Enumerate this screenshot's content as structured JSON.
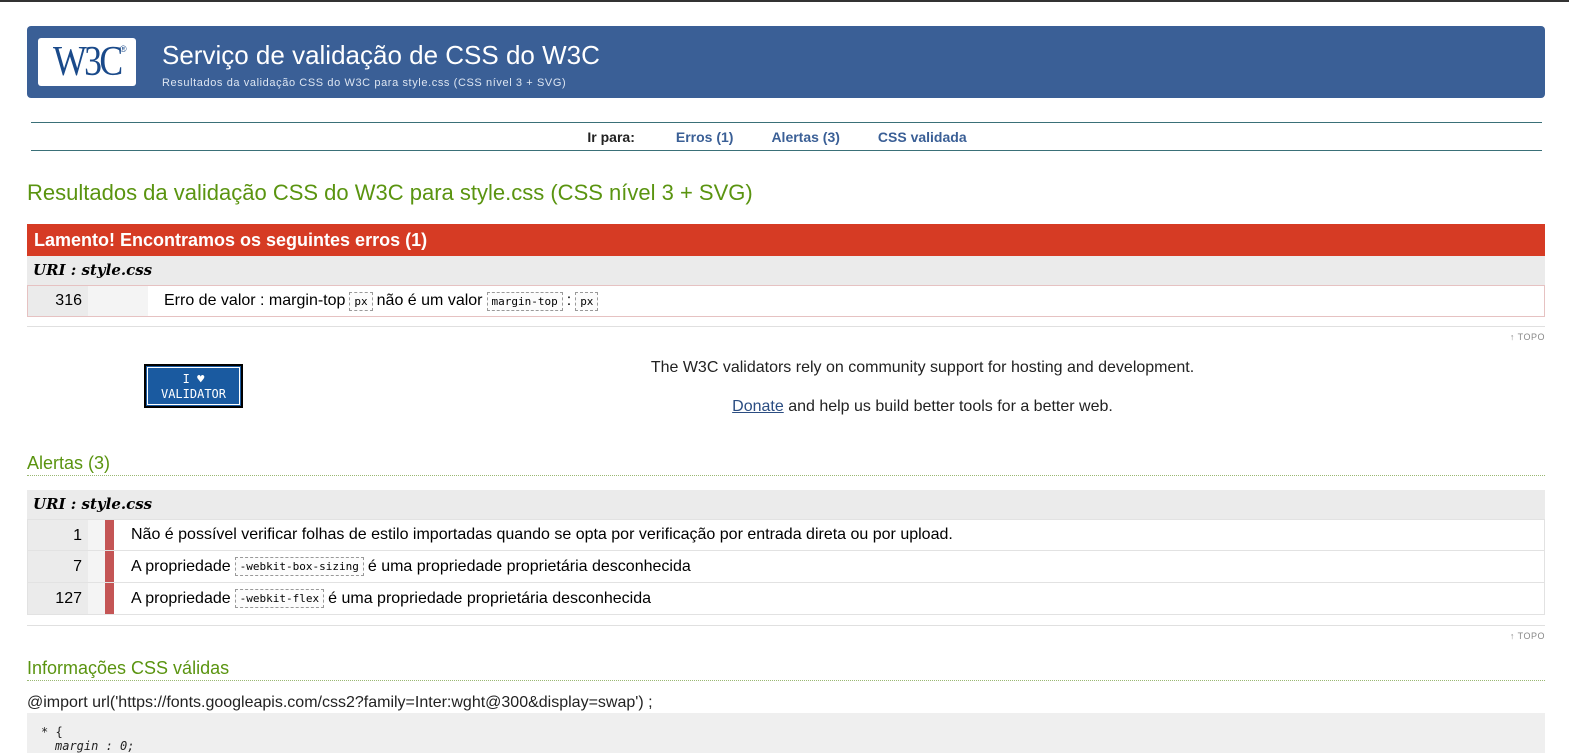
{
  "banner": {
    "logo_text": "W3C",
    "logo_reg": "®",
    "title": "Serviço de validação de CSS do W3C",
    "subtitle": "Resultados da validação CSS do W3C para style.css (CSS nível 3 + SVG)",
    "color": "#3a5f96"
  },
  "jump": {
    "label": "Ir para:",
    "links": [
      "Erros (1)",
      "Alertas (3)",
      "CSS validada"
    ]
  },
  "heading": "Resultados da validação CSS do W3C para style.css (CSS nível 3 + SVG)",
  "errors": {
    "header": "Lamento! Encontramos os seguintes erros (1)",
    "uri": "URI : style.css",
    "rows": [
      {
        "line": "316",
        "text1": "Erro de valor : margin-top",
        "code1": "px",
        "text2": "não é um valor",
        "code2": "margin-top",
        "text3": ":",
        "code3": "px"
      }
    ],
    "header_color": "#d63b24"
  },
  "topo": "↑ TOPO",
  "support": {
    "badge_line1": "I ♥",
    "badge_line2": "VALIDATOR",
    "text1": "The W3C validators rely on community support for hosting and development.",
    "donate": "Donate",
    "text2": "and help us build better tools for a better web."
  },
  "warnings": {
    "title": "Alertas (3)",
    "uri": "URI : style.css",
    "rows": [
      {
        "line": "1",
        "pre": "Não é possível verificar folhas de estilo importadas quando se opta por verificação por entrada direta ou por upload.",
        "code": "",
        "post": ""
      },
      {
        "line": "7",
        "pre": "A propriedade",
        "code": "-webkit-box-sizing",
        "post": "é uma propriedade proprietária desconhecida"
      },
      {
        "line": "127",
        "pre": "A propriedade",
        "code": "-webkit-flex",
        "post": "é uma propriedade proprietária desconhecida"
      }
    ]
  },
  "valid": {
    "title": "Informações CSS válidas",
    "import_line": "@import url('https://fonts.googleapis.com/css2?family=Inter:wght@300&display=swap') ;",
    "code_line1": "* {",
    "code_line2": "margin : 0;"
  },
  "accent_green": "#5a9410"
}
